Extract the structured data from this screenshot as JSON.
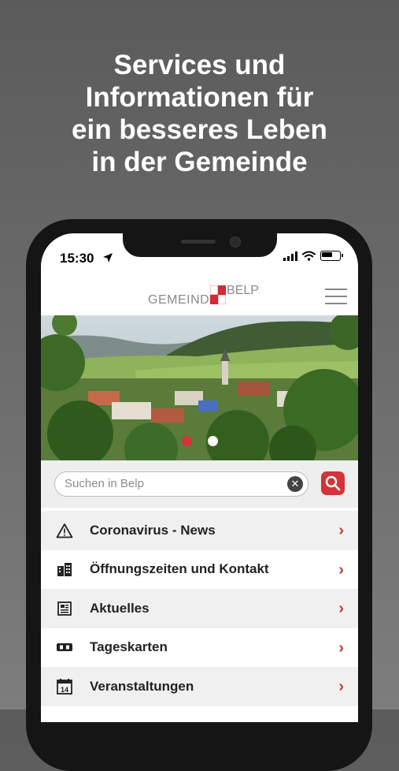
{
  "headline": "Services und\nInformationen für\nein besseres Leben\nin der Gemeinde",
  "status_bar": {
    "time": "15:30"
  },
  "header": {
    "logo_word1": "GEMEINDE",
    "logo_word2": "BELP",
    "brand_color": "#d22b33"
  },
  "carousel": {
    "slides": 2,
    "active_index": 0,
    "active_color": "#d23438",
    "inactive_color": "#ffffff"
  },
  "search": {
    "placeholder": "Suchen in Belp",
    "clear_icon": "close-circle-icon",
    "button_icon": "search-icon"
  },
  "menu": [
    {
      "label": "Coronavirus - News",
      "icon": "warning-triangle-icon"
    },
    {
      "label": "Öffnungszeiten und Kontakt",
      "icon": "buildings-icon"
    },
    {
      "label": "Aktuelles",
      "icon": "newspaper-icon"
    },
    {
      "label": "Tageskarten",
      "icon": "ticket-icon"
    },
    {
      "label": "Veranstaltungen",
      "icon": "calendar-icon",
      "icon_text": "14"
    }
  ],
  "colors": {
    "accent": "#c03a3a",
    "background": "#666666"
  }
}
